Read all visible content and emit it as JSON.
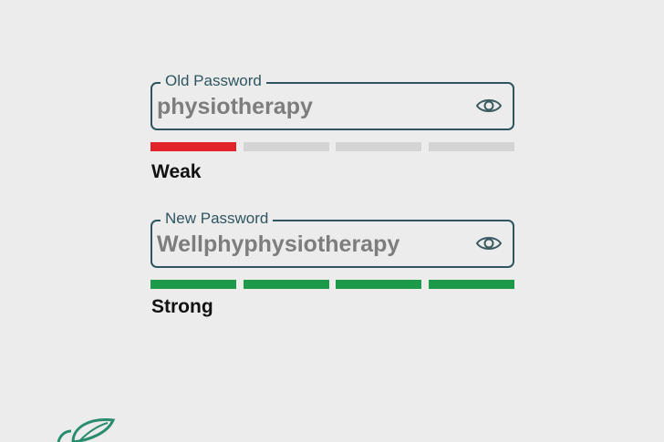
{
  "old_password": {
    "label": "Old Password",
    "value": "physiotherapy",
    "toggle_icon": "eye-icon",
    "strength": {
      "label": "Weak",
      "filled_segments": 1,
      "total_segments": 4,
      "fill_color": "#e2232a",
      "empty_color": "#d4d4d4"
    }
  },
  "new_password": {
    "label": "New Password",
    "value": "Wellphyphysiotherapy",
    "toggle_icon": "eye-icon",
    "strength": {
      "label": "Strong",
      "filled_segments": 4,
      "total_segments": 4,
      "fill_color": "#1c9a4a",
      "empty_color": "#d4d4d4"
    }
  },
  "colors": {
    "background": "#ececec",
    "field_border": "#2f5560",
    "value_text": "#7d7d7d",
    "logo_green": "#2a8c6e"
  },
  "logo": {
    "icon": "leaf-logo-icon"
  }
}
